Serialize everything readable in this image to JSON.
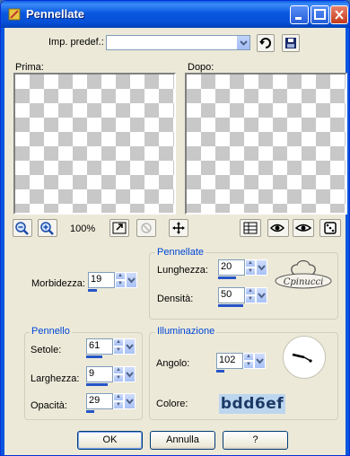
{
  "window": {
    "title": "Pennellate"
  },
  "preset": {
    "label": "Imp. predef.:",
    "value": ""
  },
  "preview": {
    "before_label": "Prima:",
    "after_label": "Dopo:"
  },
  "zoom": {
    "level": "100%"
  },
  "brush_strokes": {
    "group_label": "Pennellate",
    "softness_label": "Morbidezza:",
    "softness_value": "19",
    "length_label": "Lunghezza:",
    "length_value": "20",
    "density_label": "Densità:",
    "density_value": "50"
  },
  "brush": {
    "group_label": "Pennello",
    "bristles_label": "Setole:",
    "bristles_value": "61",
    "width_label": "Larghezza:",
    "width_value": "9",
    "opacity_label": "Opacità:",
    "opacity_value": "29"
  },
  "lighting": {
    "group_label": "Illuminazione",
    "angle_label": "Angolo:",
    "angle_value": "102",
    "color_label": "Colore:",
    "color_value": "bdd6ef"
  },
  "watermark": {
    "text": "Cpinucci"
  },
  "buttons": {
    "ok": "OK",
    "cancel": "Annulla",
    "help": "?"
  },
  "colors": {
    "titlebar": "#0a58e0",
    "dialog_bg": "#ece9d8",
    "group_label": "#0046d5",
    "light_color": "#bdd6ef"
  },
  "icons": [
    "app-icon",
    "minimize-icon",
    "maximize-icon",
    "close-icon",
    "reset-icon",
    "save-preset-icon",
    "zoom-out-icon",
    "zoom-in-icon",
    "fit-window-icon",
    "proof-icon",
    "pan-icon",
    "layout-icon",
    "randomize-icon"
  ]
}
